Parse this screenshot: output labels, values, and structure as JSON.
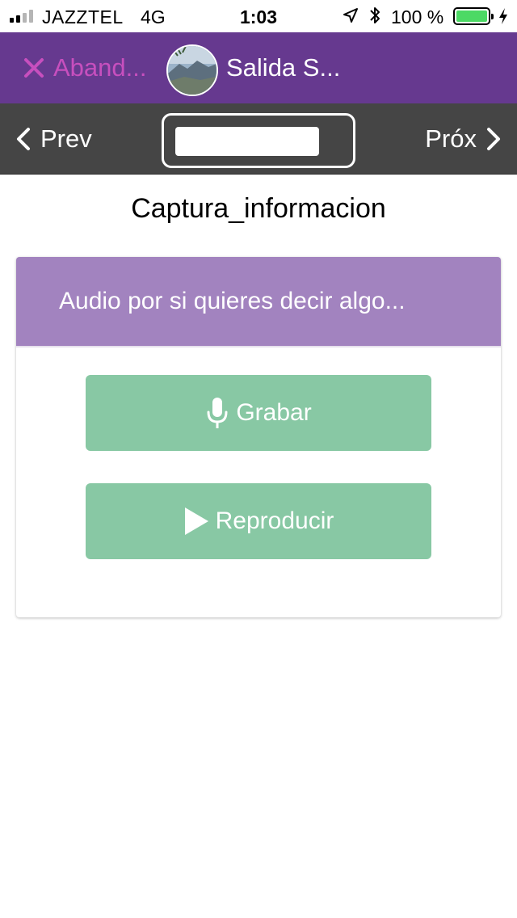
{
  "status_bar": {
    "carrier": "JAZZTEL",
    "network": "4G",
    "time": "1:03",
    "battery_percent": "100 %",
    "battery_color": "#4cd964",
    "icons": [
      "signal-icon",
      "location-icon",
      "bluetooth-icon",
      "battery-icon",
      "charging-icon"
    ]
  },
  "header": {
    "abandon_label": "Aband...",
    "title": "Salida S...",
    "background_color": "#66398f",
    "abandon_color": "#c74fbe"
  },
  "navigation": {
    "prev_label": "Prev",
    "next_label": "Próx",
    "background_color": "#454545"
  },
  "main": {
    "section_title": "Captura_informacion",
    "card": {
      "header_text": "Audio por si quieres decir algo...",
      "header_color": "#a283bf",
      "record_label": "Grabar",
      "play_label": "Reproducir",
      "button_color": "#88c8a4"
    }
  }
}
